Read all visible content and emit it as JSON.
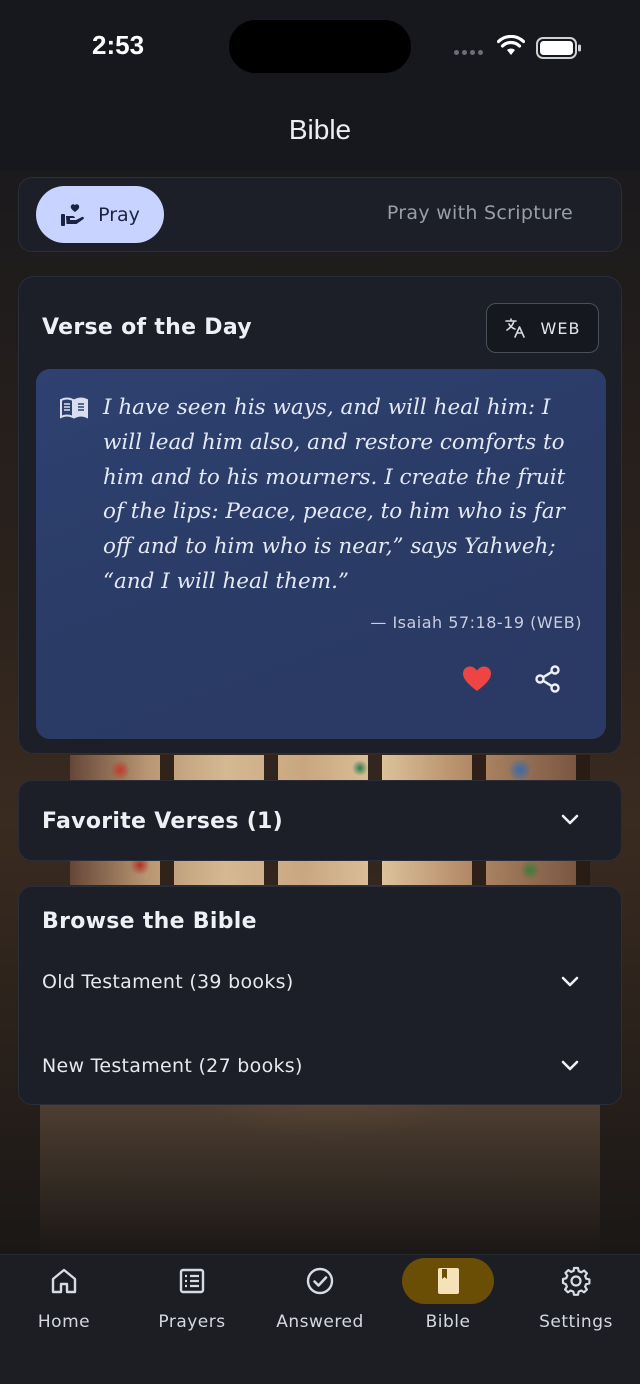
{
  "status_bar": {
    "time": "2:53"
  },
  "header": {
    "title": "Bible"
  },
  "mode_tabs": {
    "active": {
      "label": "Pray",
      "icon": "praying-hands-heart-icon"
    },
    "inactive": {
      "label": "Pray with Scripture"
    }
  },
  "verse_of_day": {
    "title": "Verse of the Day",
    "translation_button": "WEB",
    "translation_icon": "translate-icon",
    "text": "I have seen his ways, and will heal him: I will lead him also, and restore comforts to him and to his mourners. I create the fruit of the lips: Peace, peace, to him who is far off and to him who is near,” says Yahweh; “and I will heal them.”",
    "reference": "— Isaiah 57:18-19 (WEB)",
    "favorited": true,
    "colors": {
      "heart": "#ef4444",
      "card_bg": "#2e4170"
    }
  },
  "favorites": {
    "title": "Favorite Verses (1)"
  },
  "browse": {
    "title": "Browse the Bible",
    "sections": [
      {
        "label": "Old Testament (39 books)"
      },
      {
        "label": "New Testament (27 books)"
      }
    ]
  },
  "bottom_nav": {
    "items": [
      {
        "label": "Home",
        "icon": "home-icon"
      },
      {
        "label": "Prayers",
        "icon": "list-icon"
      },
      {
        "label": "Answered",
        "icon": "check-circle-icon"
      },
      {
        "label": "Bible",
        "icon": "bible-book-icon",
        "active": true
      },
      {
        "label": "Settings",
        "icon": "gear-icon"
      }
    ],
    "active_color": "#6b4e06"
  }
}
